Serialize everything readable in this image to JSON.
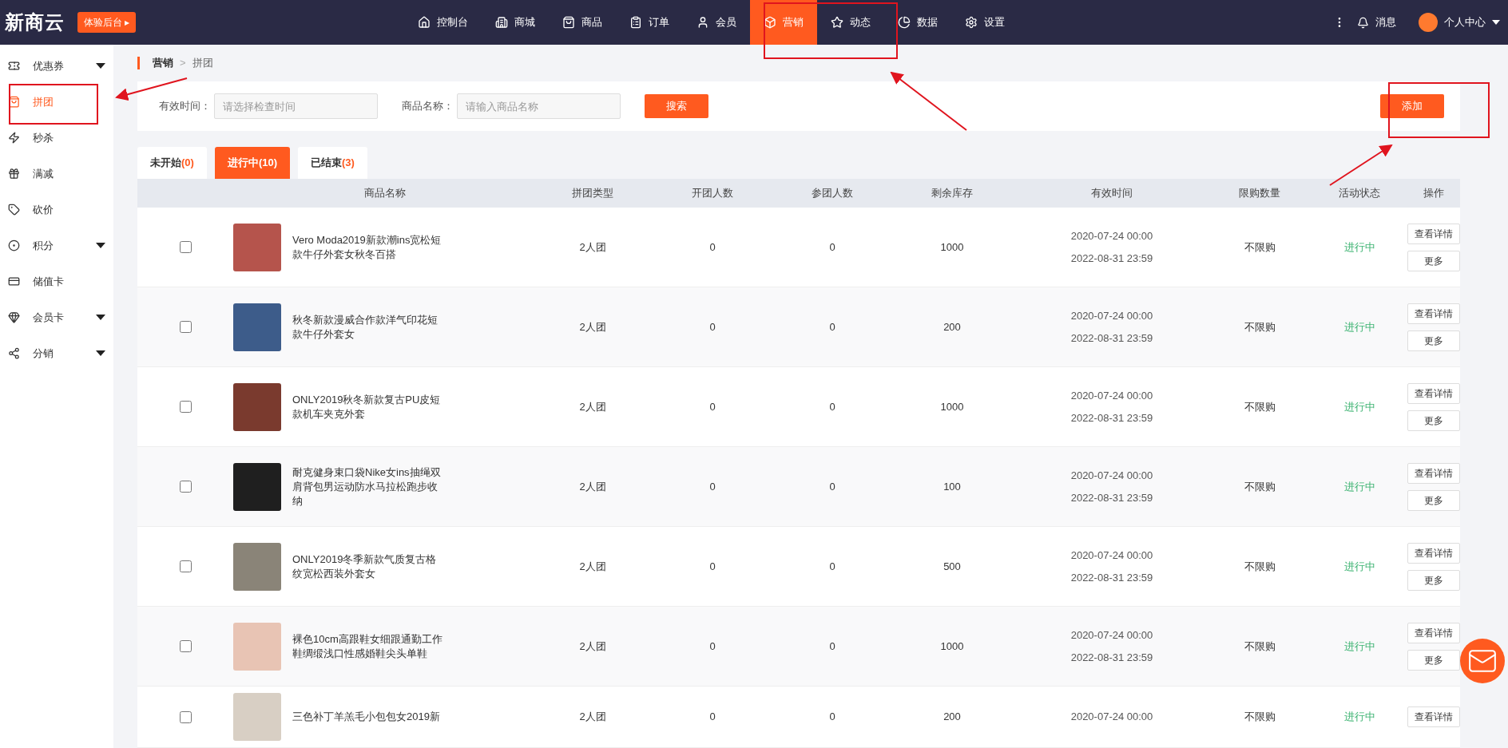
{
  "header": {
    "logo": "新商云",
    "trial_button": "体验后台 ▸",
    "nav": [
      {
        "label": "控制台",
        "selected": false
      },
      {
        "label": "商城",
        "selected": false
      },
      {
        "label": "商品",
        "selected": false
      },
      {
        "label": "订单",
        "selected": false
      },
      {
        "label": "会员",
        "selected": false
      },
      {
        "label": "营销",
        "selected": true
      },
      {
        "label": "动态",
        "selected": false
      },
      {
        "label": "数据",
        "selected": false
      },
      {
        "label": "设置",
        "selected": false
      }
    ],
    "messages": "消息",
    "account": "个人中心"
  },
  "sidebar": {
    "items": [
      {
        "label": "优惠券",
        "has_submenu": true,
        "selected": false
      },
      {
        "label": "拼团",
        "has_submenu": false,
        "selected": true
      },
      {
        "label": "秒杀",
        "has_submenu": false,
        "selected": false
      },
      {
        "label": "满减",
        "has_submenu": false,
        "selected": false
      },
      {
        "label": "砍价",
        "has_submenu": false,
        "selected": false
      },
      {
        "label": "积分",
        "has_submenu": true,
        "selected": false
      },
      {
        "label": "储值卡",
        "has_submenu": false,
        "selected": false
      },
      {
        "label": "会员卡",
        "has_submenu": true,
        "selected": false
      },
      {
        "label": "分销",
        "has_submenu": true,
        "selected": false
      }
    ]
  },
  "breadcrumb": [
    "营销",
    ">",
    "拼团"
  ],
  "filters": [
    {
      "label": "有效时间：",
      "placeholder": "请选择检查时间"
    },
    {
      "label": "商品名称：",
      "placeholder": "请输入商品名称"
    }
  ],
  "search_button": "搜索",
  "add_button": "添加",
  "tabs": [
    {
      "label": "未开始",
      "count": "(0)",
      "selected": false
    },
    {
      "label": "进行中",
      "count": "(10)",
      "selected": true
    },
    {
      "label": "已结束",
      "count": "(3)",
      "selected": false
    }
  ],
  "table": {
    "columns": [
      "商品名称",
      "拼团类型",
      "开团人数",
      "参团人数",
      "剩余库存",
      "有效时间",
      "限购数量",
      "活动状态",
      "操作"
    ],
    "rows": [
      {
        "checked": false,
        "name": "Vero Moda2019新款潮ins宽松短款牛仔外套女秋冬百搭",
        "color": "#b5544c",
        "type": "2人团",
        "open": "0",
        "joined": "0",
        "stock": "1000",
        "start": "2020-07-24 00:00",
        "end": "2022-08-31 23:59",
        "limit": "不限购",
        "status": "进行中",
        "actions": [
          "查看详情",
          "更多"
        ]
      },
      {
        "checked": false,
        "name": "秋冬新款漫威合作款洋气印花短款牛仔外套女",
        "color": "#3d5c8a",
        "type": "2人团",
        "open": "0",
        "joined": "0",
        "stock": "200",
        "start": "2020-07-24 00:00",
        "end": "2022-08-31 23:59",
        "limit": "不限购",
        "status": "进行中",
        "actions": [
          "查看详情",
          "更多"
        ]
      },
      {
        "checked": false,
        "name": "ONLY2019秋冬新款复古PU皮短款机车夹克外套",
        "color": "#7a3a2e",
        "type": "2人团",
        "open": "0",
        "joined": "0",
        "stock": "1000",
        "start": "2020-07-24 00:00",
        "end": "2022-08-31 23:59",
        "limit": "不限购",
        "status": "进行中",
        "actions": [
          "查看详情",
          "更多"
        ]
      },
      {
        "checked": false,
        "name": "耐克健身束口袋Nike女ins抽绳双肩背包男运动防水马拉松跑步收纳",
        "color": "#1f1f1f",
        "type": "2人团",
        "open": "0",
        "joined": "0",
        "stock": "100",
        "start": "2020-07-24 00:00",
        "end": "2022-08-31 23:59",
        "limit": "不限购",
        "status": "进行中",
        "actions": [
          "查看详情",
          "更多"
        ]
      },
      {
        "checked": false,
        "name": "ONLY2019冬季新款气质复古格纹宽松西装外套女",
        "color": "#8a8478",
        "type": "2人团",
        "open": "0",
        "joined": "0",
        "stock": "500",
        "start": "2020-07-24 00:00",
        "end": "2022-08-31 23:59",
        "limit": "不限购",
        "status": "进行中",
        "actions": [
          "查看详情",
          "更多"
        ]
      },
      {
        "checked": false,
        "name": "裸色10cm高跟鞋女细跟通勤工作鞋绸缎浅口性感婚鞋尖头单鞋",
        "color": "#e8c4b4",
        "type": "2人团",
        "open": "0",
        "joined": "0",
        "stock": "1000",
        "start": "2020-07-24 00:00",
        "end": "2022-08-31 23:59",
        "limit": "不限购",
        "status": "进行中",
        "actions": [
          "查看详情",
          "更多"
        ]
      },
      {
        "checked": false,
        "name": "三色补丁羊羔毛小包包女2019新",
        "color": "#d8cfc4",
        "type": "2人团",
        "open": "0",
        "joined": "0",
        "stock": "200",
        "start": "2020-07-24 00:00",
        "limit": "不限购",
        "status": "进行中",
        "actions": [
          "查看详情"
        ]
      }
    ]
  }
}
